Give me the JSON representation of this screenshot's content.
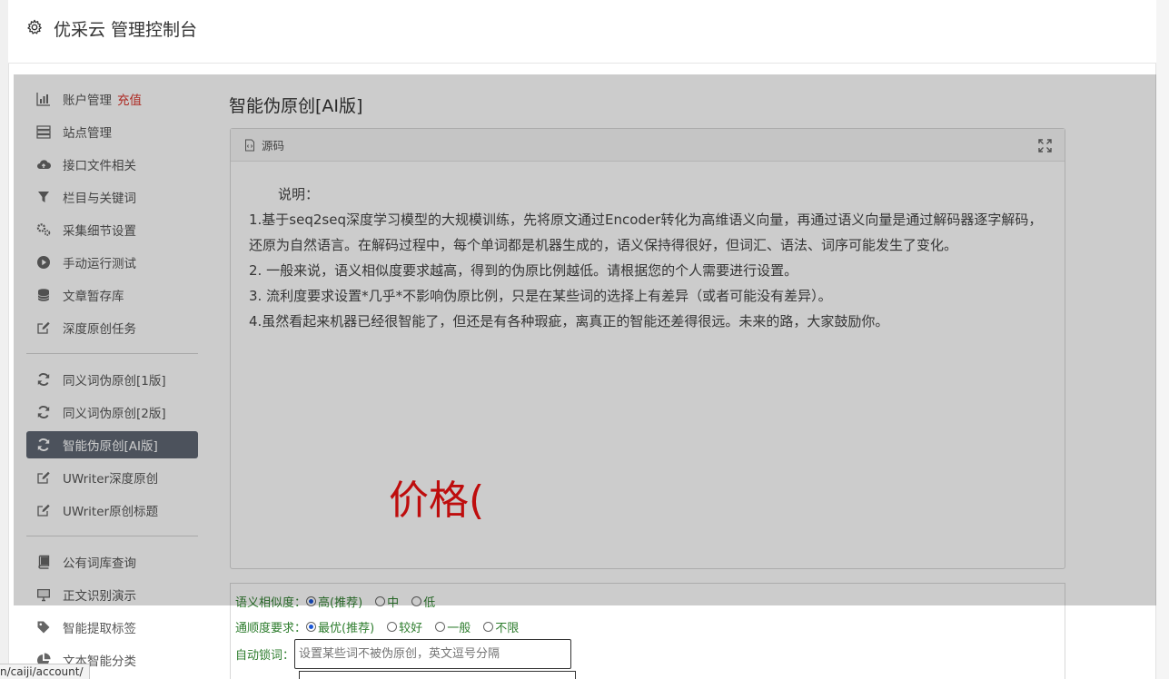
{
  "header": {
    "title": "优采云 管理控制台"
  },
  "sidebar": {
    "groups": [
      [
        {
          "label": "账户管理",
          "extra": "充值",
          "icon": "bar-chart-icon"
        },
        {
          "label": "站点管理",
          "icon": "server-icon"
        },
        {
          "label": "接口文件相关",
          "icon": "cloud-upload-icon"
        },
        {
          "label": "栏目与关键词",
          "icon": "filter-icon"
        },
        {
          "label": "采集细节设置",
          "icon": "gears-icon"
        },
        {
          "label": "手动运行测试",
          "icon": "play-icon"
        },
        {
          "label": "文章暂存库",
          "icon": "database-icon"
        },
        {
          "label": "深度原创任务",
          "icon": "edit-icon"
        }
      ],
      [
        {
          "label": "同义词伪原创[1版]",
          "icon": "refresh-icon"
        },
        {
          "label": "同义词伪原创[2版]",
          "icon": "refresh-icon"
        },
        {
          "label": "智能伪原创[AI版]",
          "icon": "refresh-icon",
          "active": true
        },
        {
          "label": "UWriter深度原创",
          "icon": "edit-icon"
        },
        {
          "label": "UWriter原创标题",
          "icon": "edit-icon"
        }
      ],
      [
        {
          "label": "公有词库查询",
          "icon": "book-icon"
        },
        {
          "label": "正文识别演示",
          "icon": "monitor-icon"
        },
        {
          "label": "智能提取标签",
          "icon": "tag-icon"
        },
        {
          "label": "文本智能分类",
          "icon": "pie-chart-icon"
        }
      ]
    ]
  },
  "main": {
    "title": "智能伪原创[AI版]",
    "panel": {
      "head_label": "源码",
      "intro": "说明：",
      "lines": [
        "1.基于seq2seq深度学习模型的大规模训练，先将原文通过Encoder转化为高维语义向量，再通过语义向量是通过解码器逐字解码，还原为自然语言。在解码过程中，每个单词都是机器生成的，语义保持得很好，但词汇、语法、词序可能发生了变化。",
        "2. 一般来说，语义相似度要求越高，得到的伪原比例越低。请根据您的个人需要进行设置。",
        "3. 流利度要求设置*几乎*不影响伪原比例，只是在某些词的选择上有差异（或者可能没有差异）。",
        "4.虽然看起来机器已经很智能了，但还是有各种瑕疵，离真正的智能还差得很远。未来的路，大家鼓励你。"
      ],
      "price_text": "价格("
    },
    "form": {
      "similarity_label": "语义相似度：",
      "similarity_options": [
        "高(推荐)",
        "中",
        "低"
      ],
      "fluency_label": "通顺度要求：",
      "fluency_options": [
        "最优(推荐)",
        "较好",
        "一般",
        "不限"
      ],
      "lock_label": "自动锁词：",
      "lock_placeholder": "设置某些词不被伪原创，英文逗号分隔"
    }
  },
  "status_bar": {
    "url": "n/caiji/account/"
  }
}
